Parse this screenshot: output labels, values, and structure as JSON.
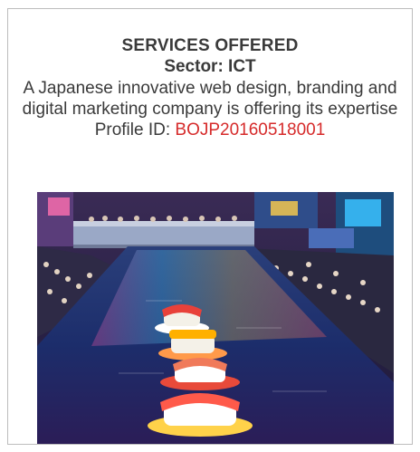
{
  "listing": {
    "headline": "SERVICES OFFERED",
    "sector": "Sector: ICT",
    "description": "A Japanese innovative web design, branding and digital marketing company is offering its expertise",
    "profile_label": "Profile ID: ",
    "profile_id": "BOJP20160518001"
  },
  "colors": {
    "profile_id": "#d62b2b",
    "text": "#3a3a3a",
    "border": "#bdbdbd"
  },
  "image": {
    "subject-icon": "photo-canal-with-sushi-floats"
  }
}
